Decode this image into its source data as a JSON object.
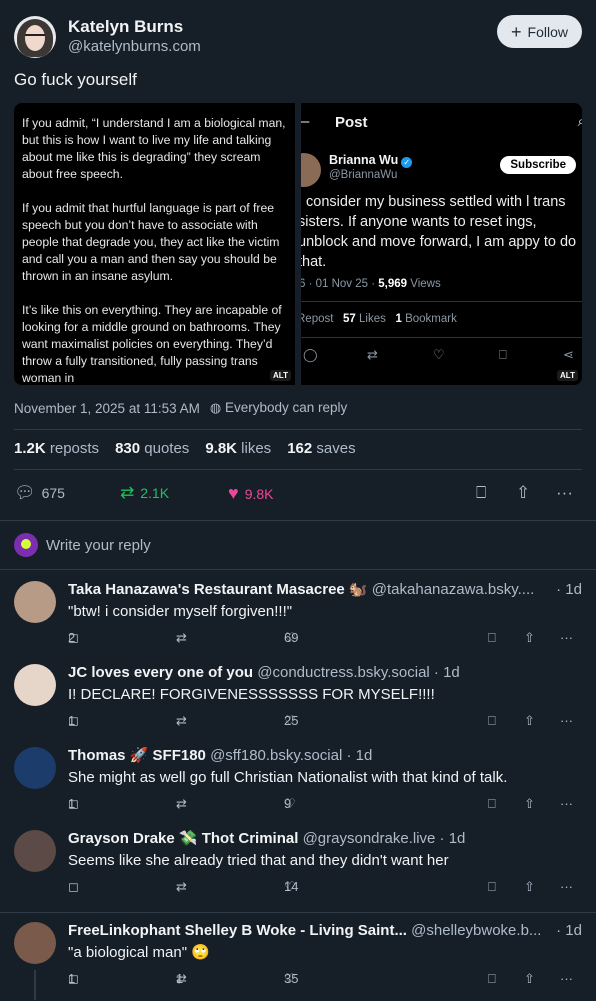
{
  "post": {
    "author_name": "Katelyn Burns",
    "author_handle": "@katelynburns.com",
    "follow_label": "Follow",
    "text": "Go fuck yourself",
    "image_left_text": "If you admit, “I understand I am a biological man, but this is how I want to live my life and talking about me like this is degrading” they scream about free speech.\n\nIf you admit that hurtful language is part of free speech but you don’t have to associate with people that degrade you, they act like the victim and call you a man and then say you should be thrown in an insane asylum.\n\nIt’s like this on everything. They are incapable of looking for a middle ground on bathrooms. They want maximalist policies on everything. They’d throw a fully transitioned, fully passing trans woman in",
    "alt_label": "ALT",
    "embed": {
      "nav_title": "Post",
      "name": "Brianna Wu",
      "handle": "@BriannaWu",
      "subscribe": "Subscribe",
      "body": "I consider my business settled with l trans sisters. If anyone wants to reset ings, unblock and move forward, I am appy to do that.",
      "date": "6 · 01 Nov 25 ·",
      "views_count": "5,969",
      "views_label": "Views",
      "repost_label": "Repost",
      "likes_count": "57",
      "likes_label": "Likes",
      "bookmark_count": "1",
      "bookmark_label": "Bookmark"
    },
    "timestamp": "November 1, 2025 at 11:53 AM",
    "reply_setting": "Everybody can reply",
    "stats": {
      "reposts_count": "1.2K",
      "reposts_label": "reposts",
      "quotes_count": "830",
      "quotes_label": "quotes",
      "likes_count": "9.8K",
      "likes_label": "likes",
      "saves_count": "162",
      "saves_label": "saves"
    },
    "actions": {
      "replies": "675",
      "reposts": "2.1K",
      "likes": "9.8K"
    }
  },
  "compose": {
    "placeholder": "Write your reply"
  },
  "replies": [
    {
      "name": "Taka Hanazawa's Restaurant Masacree 🐿️",
      "handle": "@takahanazawa.bsky....",
      "time": "· 1d",
      "text": "\"btw! i consider myself forgiven!!!\"",
      "replies": "2",
      "reposts": "",
      "likes": "69",
      "avatar_color": "#b79b86"
    },
    {
      "name": "JC loves every one of you",
      "handle": "@conductress.bsky.social · 1d",
      "time": "",
      "text": "I! DECLARE! FORGIVENESSSSSSS FOR MYSELF!!!!",
      "replies": "1",
      "reposts": "",
      "likes": "25",
      "avatar_color": "#e6d6c9"
    },
    {
      "name": "Thomas 🚀 SFF180",
      "handle": "@sff180.bsky.social · 1d",
      "time": "",
      "text": "She might as well go full Christian Nationalist with that kind of talk.",
      "replies": "1",
      "reposts": "",
      "likes": "9",
      "avatar_color": "#1c3c6b"
    },
    {
      "name": "Grayson Drake 💸 Thot Criminal",
      "handle": "@graysondrake.live · 1d",
      "time": "",
      "text": "Seems like she already tried that and they didn't want her",
      "replies": "",
      "reposts": "",
      "likes": "14",
      "avatar_color": "#5b4a45"
    },
    {
      "name": "FreeLinkophant Shelley B Woke - Living Saint...",
      "handle": "@shelleybwoke.b...",
      "time": "· 1d",
      "text": "\"a biological man\" 🙄",
      "replies": "1",
      "reposts": "1",
      "likes": "35",
      "avatar_color": "#7a5a4a"
    }
  ]
}
